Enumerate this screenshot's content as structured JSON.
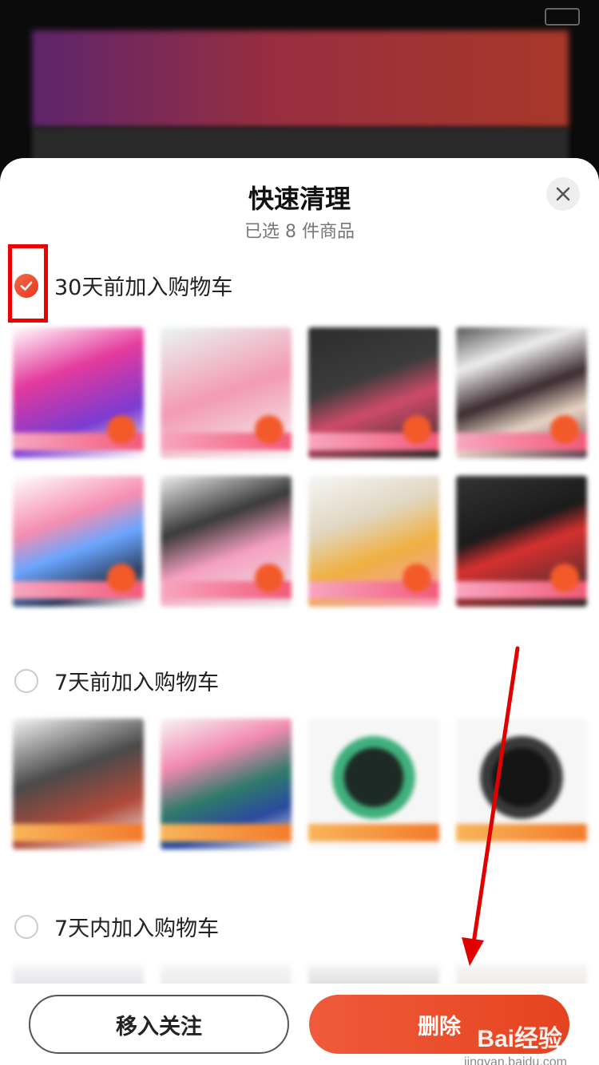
{
  "sheet": {
    "title": "快速清理",
    "subtitle": "已选 8 件商品"
  },
  "groups": [
    {
      "label": "30天前加入购物车",
      "checked": true,
      "item_count": 8
    },
    {
      "label": "7天前加入购物车",
      "checked": false,
      "item_count": 4
    },
    {
      "label": "7天内加入购物车",
      "checked": false,
      "item_count": 4
    }
  ],
  "actions": {
    "follow_label": "移入关注",
    "delete_label": "删除"
  },
  "watermark": {
    "brand": "Bai经验",
    "url": "jingyan.baidu.com"
  },
  "colors": {
    "accent": "#e8341d",
    "annotation": "#e00000"
  },
  "icons": {
    "close": "close-icon",
    "check": "check-icon"
  }
}
